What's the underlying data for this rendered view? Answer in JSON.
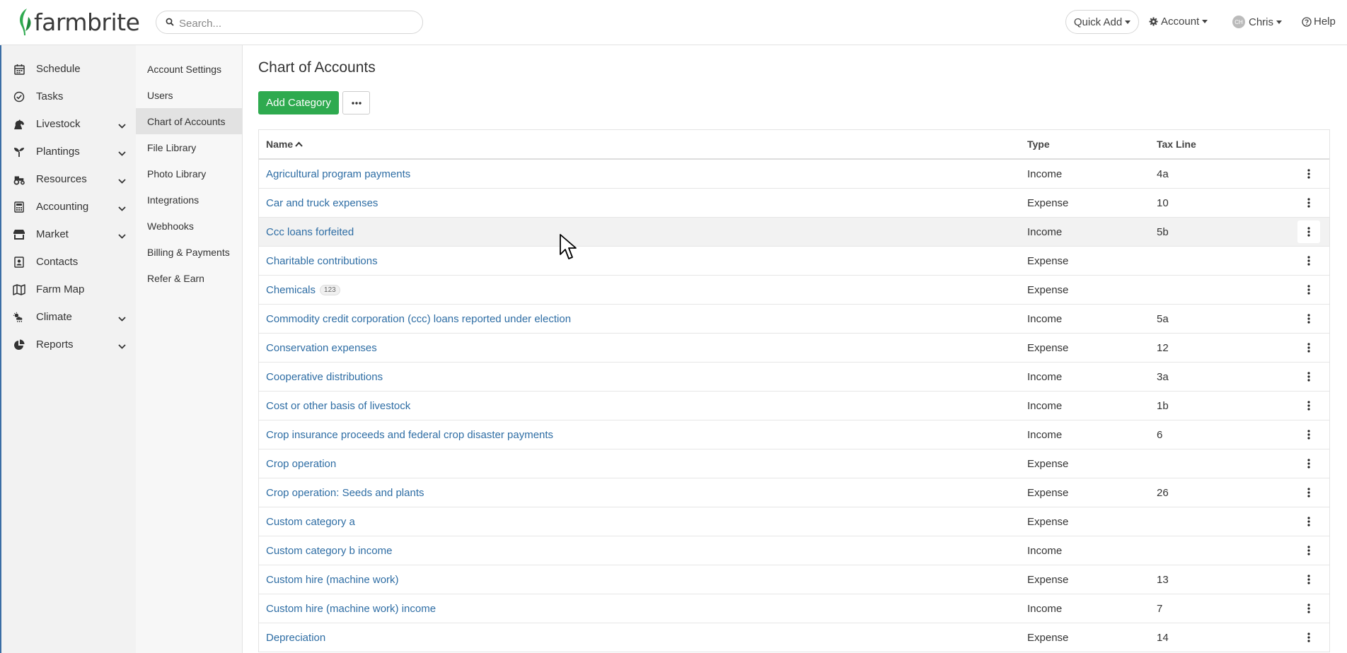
{
  "brand": {
    "name": "farmbrite",
    "leaf_color": "#2eaa4f"
  },
  "search": {
    "placeholder": "Search..."
  },
  "topbar": {
    "quick_add": "Quick Add",
    "account": "Account",
    "user_initials": "CH",
    "user_name": "Chris",
    "help": "Help"
  },
  "sidebar": {
    "items": [
      {
        "label": "Schedule",
        "icon": "calendar-icon",
        "has_chevron": false
      },
      {
        "label": "Tasks",
        "icon": "check-circle-icon",
        "has_chevron": false
      },
      {
        "label": "Livestock",
        "icon": "horse-icon",
        "has_chevron": true
      },
      {
        "label": "Plantings",
        "icon": "seedling-icon",
        "has_chevron": true
      },
      {
        "label": "Resources",
        "icon": "tractor-icon",
        "has_chevron": true
      },
      {
        "label": "Accounting",
        "icon": "calculator-icon",
        "has_chevron": true
      },
      {
        "label": "Market",
        "icon": "store-icon",
        "has_chevron": true
      },
      {
        "label": "Contacts",
        "icon": "address-book-icon",
        "has_chevron": false
      },
      {
        "label": "Farm Map",
        "icon": "map-icon",
        "has_chevron": false
      },
      {
        "label": "Climate",
        "icon": "cloud-sun-icon",
        "has_chevron": true
      },
      {
        "label": "Reports",
        "icon": "pie-chart-icon",
        "has_chevron": true
      }
    ]
  },
  "subnav": {
    "items": [
      {
        "label": "Account Settings",
        "active": false
      },
      {
        "label": "Users",
        "active": false
      },
      {
        "label": "Chart of Accounts",
        "active": true
      },
      {
        "label": "File Library",
        "active": false
      },
      {
        "label": "Photo Library",
        "active": false
      },
      {
        "label": "Integrations",
        "active": false
      },
      {
        "label": "Webhooks",
        "active": false
      },
      {
        "label": "Billing & Payments",
        "active": false
      },
      {
        "label": "Refer & Earn",
        "active": false
      }
    ]
  },
  "main": {
    "title": "Chart of Accounts",
    "add_button": "Add Category",
    "table": {
      "columns": {
        "name": "Name",
        "type": "Type",
        "tax_line": "Tax Line"
      },
      "rows": [
        {
          "name": "Agricultural program payments",
          "badge": "",
          "type": "Income",
          "tax_line": "4a"
        },
        {
          "name": "Car and truck expenses",
          "badge": "",
          "type": "Expense",
          "tax_line": "10"
        },
        {
          "name": "Ccc loans forfeited",
          "badge": "",
          "type": "Income",
          "tax_line": "5b"
        },
        {
          "name": "Charitable contributions",
          "badge": "",
          "type": "Expense",
          "tax_line": ""
        },
        {
          "name": "Chemicals",
          "badge": "123",
          "type": "Expense",
          "tax_line": ""
        },
        {
          "name": "Commodity credit corporation (ccc) loans reported under election",
          "badge": "",
          "type": "Income",
          "tax_line": "5a"
        },
        {
          "name": "Conservation expenses",
          "badge": "",
          "type": "Expense",
          "tax_line": "12"
        },
        {
          "name": "Cooperative distributions",
          "badge": "",
          "type": "Income",
          "tax_line": "3a"
        },
        {
          "name": "Cost or other basis of livestock",
          "badge": "",
          "type": "Income",
          "tax_line": "1b"
        },
        {
          "name": "Crop insurance proceeds and federal crop disaster payments",
          "badge": "",
          "type": "Income",
          "tax_line": "6"
        },
        {
          "name": "Crop operation",
          "badge": "",
          "type": "Expense",
          "tax_line": ""
        },
        {
          "name": "Crop operation: Seeds and plants",
          "badge": "",
          "type": "Expense",
          "tax_line": "26"
        },
        {
          "name": "Custom category a",
          "badge": "",
          "type": "Expense",
          "tax_line": ""
        },
        {
          "name": "Custom category b income",
          "badge": "",
          "type": "Income",
          "tax_line": ""
        },
        {
          "name": "Custom hire (machine work)",
          "badge": "",
          "type": "Expense",
          "tax_line": "13"
        },
        {
          "name": "Custom hire (machine work) income",
          "badge": "",
          "type": "Income",
          "tax_line": "7"
        },
        {
          "name": "Depreciation",
          "badge": "",
          "type": "Expense",
          "tax_line": "14"
        }
      ]
    }
  }
}
